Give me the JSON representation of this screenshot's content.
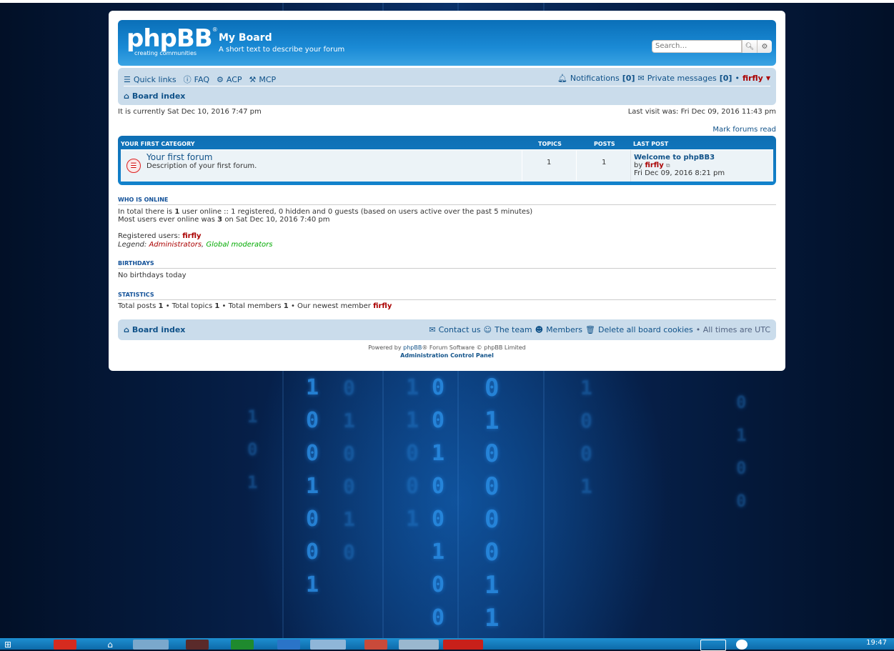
{
  "header": {
    "site_name": "My Board",
    "site_description": "A short text to describe your forum",
    "logo_text": "phpBB",
    "logo_tagline": "creating   communities",
    "search_placeholder": "Search…"
  },
  "navbar": {
    "quick_links": "Quick links",
    "faq": "FAQ",
    "acp": "ACP",
    "mcp": "MCP",
    "notifications_label": "Notifications",
    "notifications_count": "[0]",
    "private_messages_label": "Private messages",
    "private_messages_count": "[0]",
    "bullet": "•",
    "username": "firfly",
    "breadcrumb": "Board index"
  },
  "status": {
    "current_time": "It is currently Sat Dec 10, 2016 7:47 pm",
    "last_visit": "Last visit was: Fri Dec 09, 2016 11:43 pm",
    "mark_read": "Mark forums read"
  },
  "category": {
    "title": "YOUR FIRST CATEGORY",
    "col_topics": "TOPICS",
    "col_posts": "POSTS",
    "col_last_post": "LAST POST",
    "forums": [
      {
        "name": "Your first forum",
        "description": "Description of your first forum.",
        "topics": "1",
        "posts": "1",
        "last_post_title": "Welcome to phpBB3",
        "last_post_by": "by",
        "last_post_author": "firfly",
        "last_post_time": "Fri Dec 09, 2016 8:21 pm"
      }
    ]
  },
  "who_is_online": {
    "heading": "WHO IS ONLINE",
    "line1_a": "In total there is",
    "line1_count": "1",
    "line1_b": "user online :: 1 registered, 0 hidden and 0 guests (based on users active over the past 5 minutes)",
    "line2_a": "Most users ever online was",
    "line2_count": "3",
    "line2_b": "on Sat Dec 10, 2016 7:40 pm",
    "registered_label": "Registered users:",
    "registered_user": "firfly",
    "legend_label": "Legend:",
    "legend_admins": "Administrators",
    "legend_comma": ",",
    "legend_mods": "Global moderators"
  },
  "birthdays": {
    "heading": "BIRTHDAYS",
    "text": "No birthdays today"
  },
  "statistics": {
    "heading": "STATISTICS",
    "posts_label": "Total posts",
    "posts": "1",
    "topics_label": "• Total topics",
    "topics": "1",
    "members_label": "• Total members",
    "members": "1",
    "newest_label": "• Our newest member",
    "newest": "firfly"
  },
  "footer": {
    "board_index": "Board index",
    "contact": "Contact us",
    "team": "The team",
    "members": "Members",
    "delete_cookies": "Delete all board cookies",
    "timezone": "• All times are UTC",
    "powered_a": "Powered by",
    "powered_link": "phpBB",
    "powered_b": "® Forum Software © phpBB Limited",
    "acp_link": "Administration Control Panel"
  },
  "taskbar": {
    "clock": "19:47"
  },
  "colors": {
    "header_blue": "#1a8ad5",
    "nav_bg": "#cadceb",
    "link_blue": "#105289",
    "admin_red": "#aa0000",
    "mod_green": "#00aa00"
  }
}
